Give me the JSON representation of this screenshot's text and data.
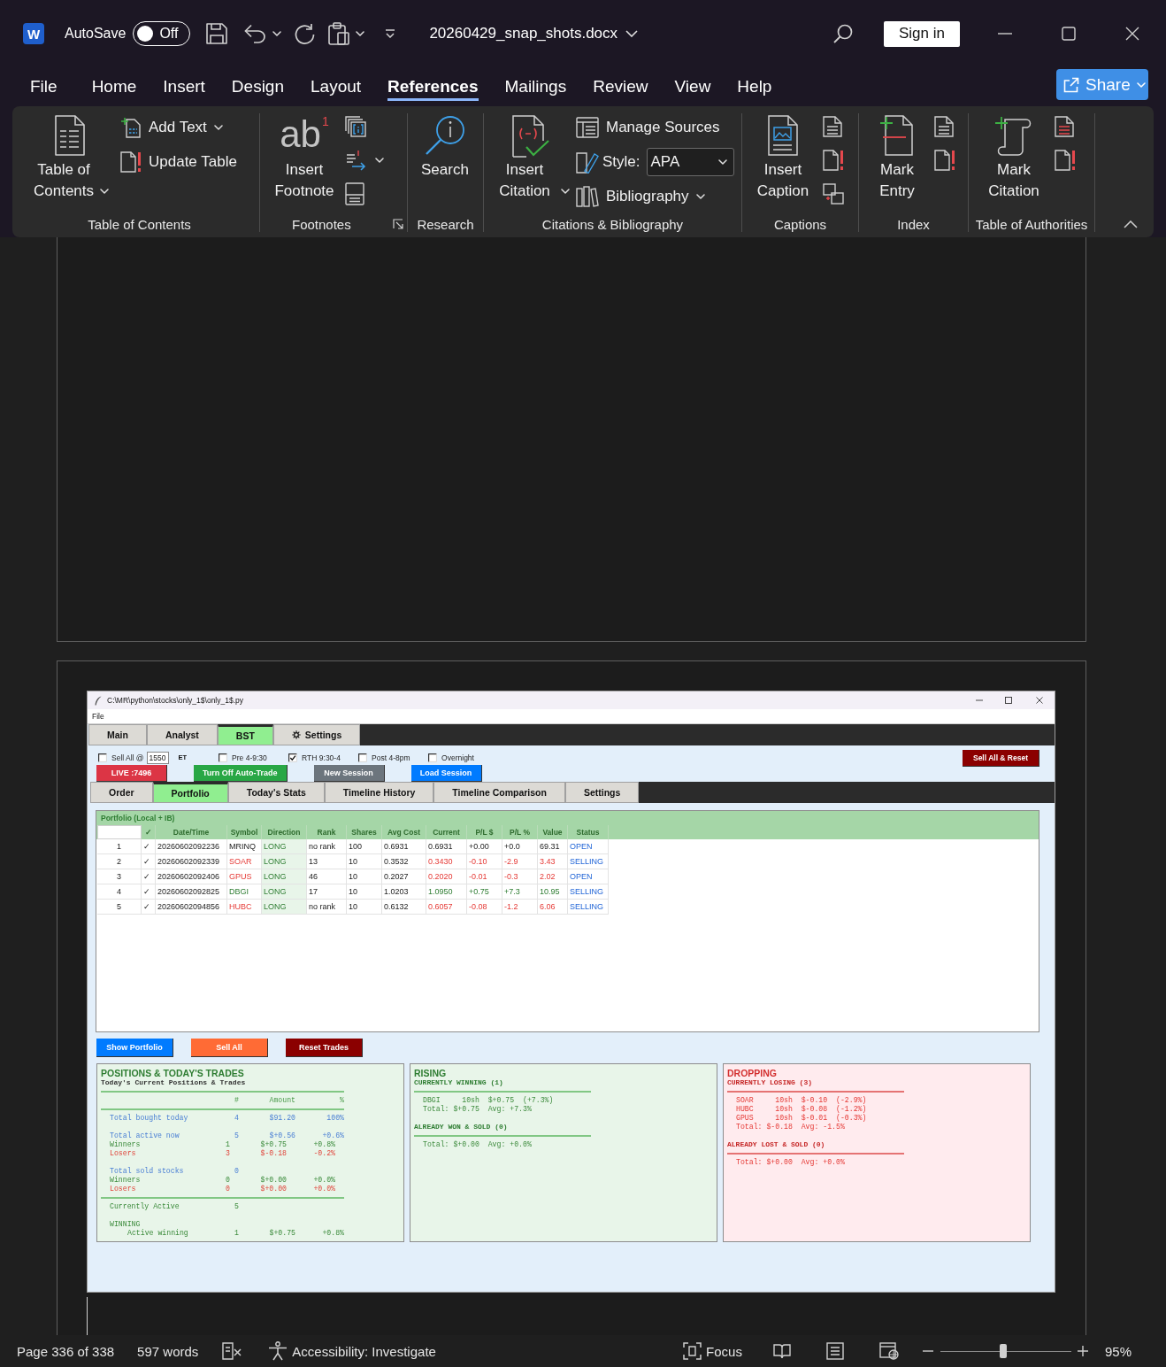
{
  "titlebar": {
    "logo": "W",
    "autosave": {
      "label": "AutoSave",
      "on": false,
      "state": "Off"
    },
    "filename": "20260429_snap_shots.docx",
    "sign_in": "Sign in"
  },
  "menu": {
    "tabs": [
      {
        "label": "File",
        "selected": false
      },
      {
        "label": "Home",
        "selected": false
      },
      {
        "label": "Insert",
        "selected": false
      },
      {
        "label": "Design",
        "selected": false
      },
      {
        "label": "Layout",
        "selected": false
      },
      {
        "label": "References",
        "selected": true
      },
      {
        "label": "Mailings",
        "selected": false
      },
      {
        "label": "Review",
        "selected": false
      },
      {
        "label": "View",
        "selected": false
      },
      {
        "label": "Help",
        "selected": false
      }
    ],
    "share": "Share"
  },
  "ribbon": {
    "groups": [
      {
        "kind": "toc",
        "label": "Table of Contents",
        "large": {
          "label": "Table of Contents",
          "dropdown": true
        },
        "small": [
          {
            "label": "Add Text",
            "dropdown": true
          },
          {
            "label": "Update Table",
            "dropdown": false
          }
        ]
      },
      {
        "kind": "footnotes",
        "label": "Footnotes",
        "glyph": "ab",
        "glyph_mark": "1",
        "large": {
          "label": "Insert Footnote",
          "dropdown": false
        }
      },
      {
        "kind": "research",
        "label": "Research",
        "large": {
          "label": "Search",
          "dropdown": false
        }
      },
      {
        "kind": "citations",
        "label": "Citations & Bibliography",
        "large": {
          "label": "Insert Citation",
          "dropdown": true
        },
        "small": [
          {
            "label": "Manage Sources",
            "dropdown": false
          },
          {
            "label": "Bibliography",
            "dropdown": true
          }
        ],
        "style": {
          "label": "Style:",
          "value": "APA"
        }
      },
      {
        "kind": "captions",
        "label": "Captions",
        "large": {
          "label": "Insert Caption",
          "dropdown": false
        }
      },
      {
        "kind": "index",
        "label": "Index",
        "large": {
          "label": "Mark Entry",
          "dropdown": false
        }
      },
      {
        "kind": "authorities",
        "label": "Table of Authorities",
        "large": {
          "label": "Mark Citation",
          "dropdown": false
        }
      }
    ]
  },
  "document": {
    "embedded_app": {
      "title": "C:\\MR\\python\\stocks\\only_1$\\only_1$.py",
      "menu": [
        "File"
      ],
      "tabs": [
        {
          "label": "Main",
          "selected": false,
          "kind": "text"
        },
        {
          "label": "Analyst",
          "selected": false,
          "kind": "text"
        },
        {
          "label": "BST",
          "selected": true,
          "kind": "text"
        },
        {
          "label": "Settings",
          "selected": false,
          "kind": "icon"
        }
      ],
      "options": [
        {
          "kind": "checkbox",
          "label": "Sell All @",
          "checked": false
        },
        {
          "kind": "field",
          "value": "1550"
        },
        {
          "kind": "text",
          "label": "ET"
        },
        {
          "kind": "checkbox",
          "label": "Pre 4-9:30",
          "checked": false
        },
        {
          "kind": "checkbox",
          "label": "RTH 9:30-4",
          "checked": true
        },
        {
          "kind": "checkbox",
          "label": "Post 4-8pm",
          "checked": false
        },
        {
          "kind": "checkbox",
          "label": "Overnight",
          "checked": false
        }
      ],
      "reset_button": "Sell All & Reset",
      "action_buttons": [
        {
          "label": "LIVE :7496",
          "color": "#dc3545"
        },
        {
          "label": "Turn Off Auto-Trade",
          "color": "#28a745"
        },
        {
          "label": "New Session",
          "color": "#6c757d"
        },
        {
          "label": "Load Session",
          "color": "#007bff"
        }
      ],
      "sub_tabs": [
        {
          "label": "Order",
          "selected": false
        },
        {
          "label": "Portfolio",
          "selected": true
        },
        {
          "label": "Today's Stats",
          "selected": false
        },
        {
          "label": "Timeline History",
          "selected": false
        },
        {
          "label": "Timeline Comparison",
          "selected": false
        },
        {
          "label": "Settings",
          "selected": false
        }
      ],
      "portfolio": {
        "title": "Portfolio (Local + IB)",
        "columns": [
          "✓",
          "Date/Time",
          "Symbol",
          "Direction",
          "Rank",
          "Shares",
          "Avg Cost",
          "Current",
          "P/L $",
          "P/L %",
          "Value",
          "Status"
        ],
        "rows": [
          {
            "index": "1",
            "gain": false,
            "loss": false,
            "cells": [
              "✓",
              "20260602092236",
              "MRINQ",
              "LONG",
              "no rank",
              "100",
              "0.6931",
              "0.6931",
              "+0.00",
              "+0.0",
              "69.31",
              "OPEN"
            ]
          },
          {
            "index": "2",
            "gain": false,
            "loss": true,
            "cells": [
              "✓",
              "20260602092339",
              "SOAR",
              "LONG",
              "13",
              "10",
              "0.3532",
              "0.3430",
              "-0.10",
              "-2.9",
              "3.43",
              "SELLING"
            ]
          },
          {
            "index": "3",
            "gain": false,
            "loss": true,
            "cells": [
              "✓",
              "20260602092406",
              "GPUS",
              "LONG",
              "46",
              "10",
              "0.2027",
              "0.2020",
              "-0.01",
              "-0.3",
              "2.02",
              "OPEN"
            ]
          },
          {
            "index": "4",
            "gain": true,
            "loss": false,
            "cells": [
              "✓",
              "20260602092825",
              "DBGI",
              "LONG",
              "17",
              "10",
              "1.0203",
              "1.0950",
              "+0.75",
              "+7.3",
              "10.95",
              "SELLING"
            ]
          },
          {
            "index": "5",
            "gain": false,
            "loss": true,
            "cells": [
              "✓",
              "20260602094856",
              "HUBC",
              "LONG",
              "no rank",
              "10",
              "0.6132",
              "0.6057",
              "-0.08",
              "-1.2",
              "6.06",
              "SELLING"
            ]
          }
        ]
      },
      "bottom_buttons": [
        {
          "label": "Show Portfolio",
          "color": "#007bff"
        },
        {
          "label": "Sell All",
          "color": "#ff6b35"
        },
        {
          "label": "Reset Trades",
          "color": "#8b0000"
        }
      ],
      "summary_panels": [
        {
          "kind": "positions",
          "title": "POSITIONS & TODAY'S TRADES",
          "subtitle": "Today's Current Positions & Trades",
          "header": [
            "#",
            "Amount",
            "%"
          ],
          "blocks": [
            [
              {
                "kind": "total",
                "label": "Total bought today",
                "count": "4",
                "amount": "$91.20",
                "percent": "100%"
              }
            ],
            [
              {
                "kind": "total",
                "label": "Total active now",
                "count": "5",
                "amount": "$+0.56",
                "percent": "+0.6%"
              },
              {
                "kind": "winner",
                "label": "Winners",
                "count": "1",
                "amount": "$+0.75",
                "percent": "+0.8%"
              },
              {
                "kind": "loser",
                "label": "Losers",
                "count": "3",
                "amount": "$-0.18",
                "percent": "-0.2%"
              }
            ],
            [
              {
                "kind": "total",
                "label": "Total sold stocks",
                "count": "0"
              },
              {
                "kind": "winner",
                "label": "Winners",
                "count": "0",
                "amount": "$+0.00",
                "percent": "+0.0%"
              },
              {
                "kind": "loser",
                "label": "Losers",
                "count": "0",
                "amount": "$+0.00",
                "percent": "+0.0%"
              }
            ]
          ],
          "footer_blocks": [
            [
              {
                "kind": "active",
                "label": "Currently Active",
                "count": "5"
              }
            ],
            [
              {
                "kind": "heading",
                "label": "WINNING"
              },
              {
                "kind": "item",
                "label": "Active winning",
                "count": "1",
                "amount": "$+0.75",
                "percent": "+0.8%"
              }
            ]
          ]
        },
        {
          "kind": "rising",
          "title": "RISING",
          "sections": [
            {
              "heading": "CURRENTLY WINNING (1)",
              "lines": [
                "DBGI     10sh  $+0.75  (+7.3%)",
                "Total: $+0.75  Avg: +7.3%"
              ]
            },
            {
              "heading": "ALREADY WON & SOLD (0)",
              "lines": [
                "Total: $+0.00  Avg: +0.0%"
              ]
            }
          ]
        },
        {
          "kind": "dropping",
          "title": "DROPPING",
          "sections": [
            {
              "heading": "CURRENTLY LOSING (3)",
              "lines": [
                "SOAR     10sh  $-0.10  (-2.9%)",
                "HUBC     10sh  $-0.08  (-1.2%)",
                "GPUS     10sh  $-0.01  (-0.3%)",
                "Total: $-0.18  Avg: -1.5%"
              ]
            },
            {
              "heading": "ALREADY LOST & SOLD (0)",
              "lines": [
                "Total: $+0.00  Avg: +0.0%"
              ]
            }
          ]
        }
      ]
    }
  },
  "status_bar": {
    "page": "Page 336 of 338",
    "words": "597 words",
    "accessibility": "Accessibility: Investigate",
    "focus": "Focus",
    "zoom": {
      "level": 0.48,
      "reading": "95%"
    }
  }
}
